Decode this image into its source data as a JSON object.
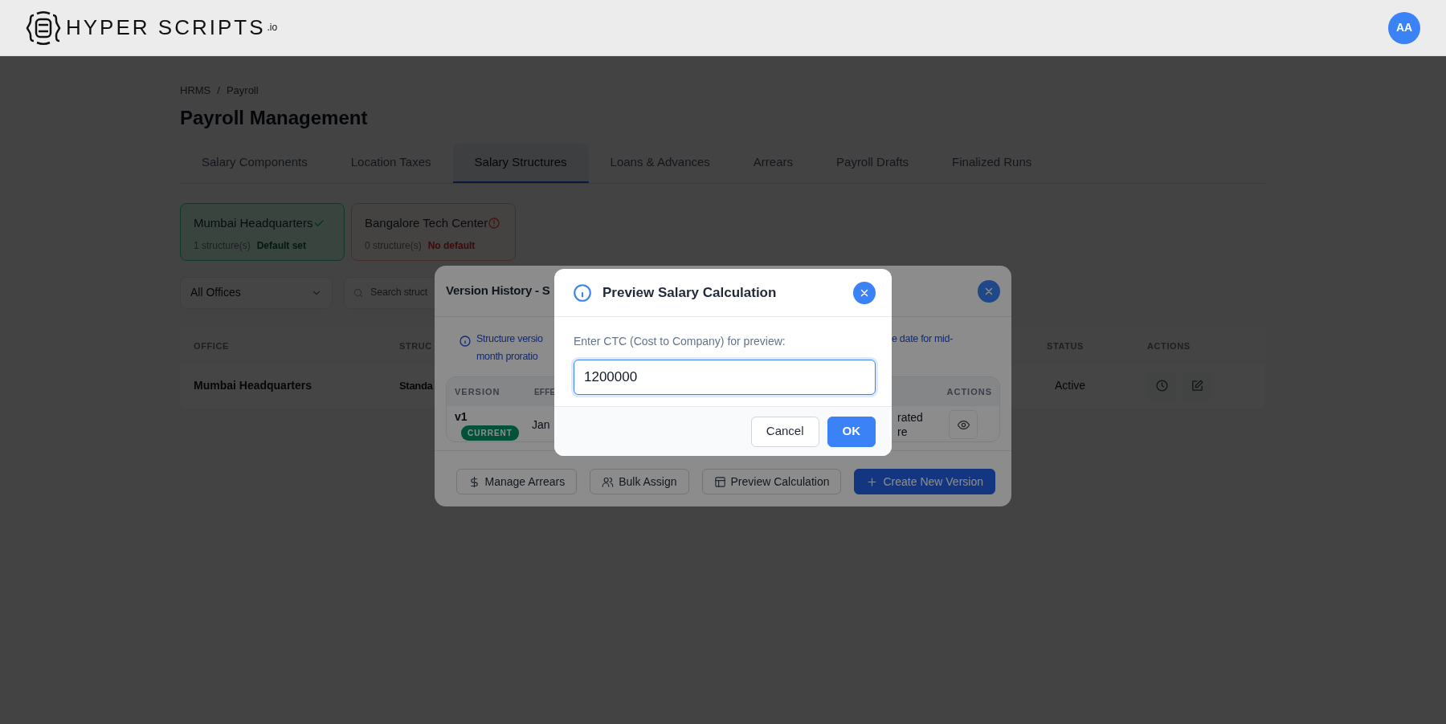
{
  "header": {
    "logo_text": "HYPER SCRIPTS",
    "logo_suffix": ".io",
    "avatar": "AA"
  },
  "breadcrumb": {
    "items": [
      "HRMS",
      "Payroll"
    ],
    "separator": "/"
  },
  "page_title": "Payroll Management",
  "tabs": [
    {
      "label": "Salary Components",
      "selected": false
    },
    {
      "label": "Location Taxes",
      "selected": false
    },
    {
      "label": "Salary Structures",
      "selected": true
    },
    {
      "label": "Loans & Advances",
      "selected": false
    },
    {
      "label": "Arrears",
      "selected": false
    },
    {
      "label": "Payroll Drafts",
      "selected": false
    },
    {
      "label": "Finalized Runs",
      "selected": false
    }
  ],
  "office_cards": [
    {
      "name": "Mumbai Headquarters",
      "count": "1 structure(s)",
      "default_label": "Default set",
      "default_set": true
    },
    {
      "name": "Bangalore Tech Center",
      "count": "0 structure(s)",
      "default_label": "No default",
      "default_set": false
    }
  ],
  "filters": {
    "office_select": "All Offices",
    "search_placeholder": "Search struct"
  },
  "table": {
    "columns": [
      "OFFICE",
      "STRUC",
      "STATUS",
      "ACTIONS"
    ],
    "rows": [
      {
        "office": "Mumbai Headquarters",
        "structure": "Standa",
        "status": "Active"
      }
    ]
  },
  "version_history": {
    "title": "Version History - S",
    "info_left": [
      "Structure versio",
      "month proratio"
    ],
    "info_right": "e date for mid-",
    "table": {
      "columns": [
        "VERSION",
        "EFFE",
        "ACTIONS"
      ],
      "rows": [
        {
          "version": "v1",
          "badge": "CURRENT",
          "effective": "Jan",
          "column_4": [
            "rated",
            "re"
          ]
        }
      ]
    },
    "buttons": [
      {
        "label": "Manage Arrears",
        "kind": "dollar",
        "primary": false
      },
      {
        "label": "Bulk Assign",
        "kind": "users",
        "primary": false
      },
      {
        "label": "Preview Calculation",
        "kind": "table",
        "primary": false
      },
      {
        "label": "Create New Version",
        "kind": "plus",
        "primary": true
      }
    ]
  },
  "dialog": {
    "title": "Preview Salary Calculation",
    "label": "Enter CTC (Cost to Company) for preview:",
    "value": "1200000",
    "buttons": [
      {
        "label": "Cancel",
        "primary": false
      },
      {
        "label": "OK",
        "primary": true
      }
    ]
  }
}
